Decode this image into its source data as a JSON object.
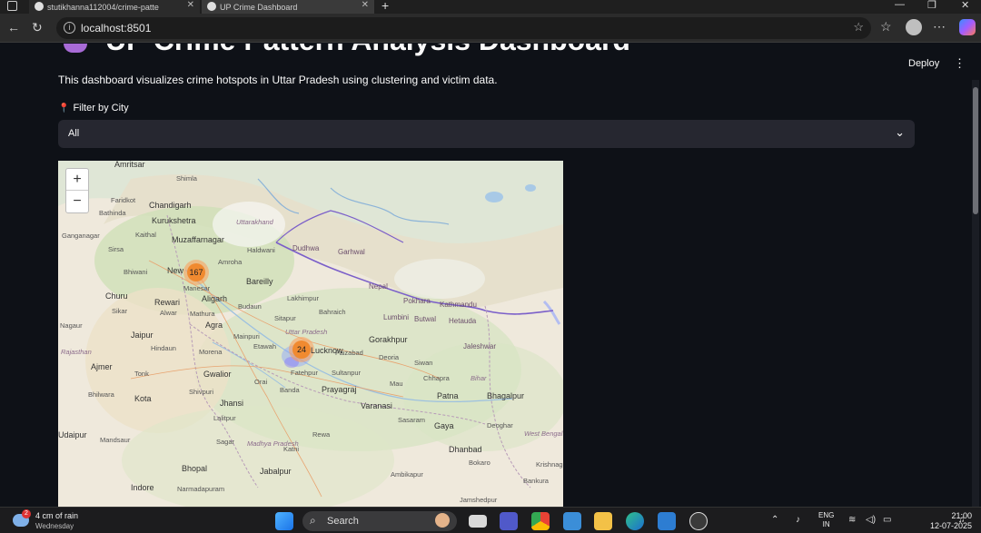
{
  "browser": {
    "tabs": [
      {
        "label": "stutikhanna112004/crime-patte"
      },
      {
        "label": "UP Crime Dashboard"
      }
    ],
    "new_tab": "+",
    "url": "localhost:8501",
    "window_controls": {
      "minimize": "—",
      "maximize": "❐",
      "close": "✕"
    }
  },
  "app": {
    "title": "UP Crime Pattern Analysis Dashboard",
    "deploy_label": "Deploy",
    "menu_icon": "⋮",
    "description": "This dashboard visualizes crime hotspots in Uttar Pradesh using clustering and victim data.",
    "filter": {
      "icon": "📍",
      "label": "Filter by City",
      "selected": "All"
    }
  },
  "map": {
    "zoom_in": "+",
    "zoom_out": "−",
    "clusters": [
      {
        "count": "167"
      },
      {
        "count": "24"
      }
    ],
    "labels": [
      "Amritsar",
      "Shimla",
      "Faridkot",
      "Chandigarh",
      "Bathinda",
      "Kurukshetra",
      "Ganganagar",
      "Sirsa",
      "Kaithal",
      "Muzaffarnagar",
      "Haldwani",
      "Bhiwani",
      "Amroha",
      "Bareilly",
      "Churu",
      "Rewari",
      "Aligarh",
      "Manesar",
      "Sikar",
      "Alwar",
      "Budaun",
      "Agra",
      "Mathura",
      "Nagaur",
      "Jaipur",
      "Mainpuri",
      "Etawah",
      "Lakhimpur",
      "Sitapur",
      "Bahraich",
      "Hindaun",
      "Morena",
      "Gwalior",
      "Jhansi",
      "Orai",
      "Banda",
      "Prayagraj",
      "Varanasi",
      "Gorakhpur",
      "Faizabad",
      "Deoria",
      "Siwan",
      "Chhapra",
      "Patna",
      "Bhagalpur",
      "Ajmer",
      "Tonk",
      "Kota",
      "Bhilwara",
      "Shivpuri",
      "Lalitpur",
      "Sagar",
      "Katni",
      "Rewa",
      "Sasaram",
      "Gaya",
      "Deoghar",
      "Udaipur",
      "Mandsaur",
      "Bhopal",
      "Jabalpur",
      "Ambikapur",
      "Dhanbad",
      "Bokaro",
      "Indore",
      "Narmadapuram",
      "Jamshedpur",
      "Krishnagar",
      "Bankura",
      "Fatehpur",
      "Sultanpur",
      "Mau",
      "Uttar Pradesh",
      "Rajasthan",
      "Madhya Pradesh",
      "Bihar",
      "Uttarakhand",
      "West Bengal",
      "New",
      "Dudhwa",
      "Garhwal",
      "Nepal",
      "Kathmandu",
      "Pokhara",
      "Lumbini",
      "Butwal",
      "Jaleshwar",
      "Hetauda",
      "Lucknow"
    ]
  },
  "taskbar": {
    "weather_temp": "4 cm of rain",
    "weather_day": "Wednesday",
    "weather_badge": "2",
    "search_label": "Search",
    "lang_1": "ENG",
    "lang_2": "IN",
    "time": "21:00",
    "date": "12-07-2025"
  }
}
